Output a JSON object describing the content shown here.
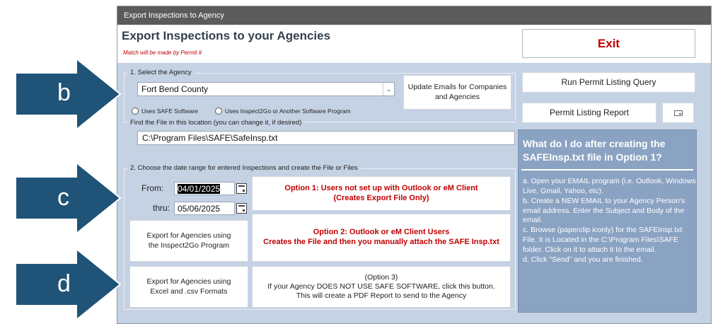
{
  "window": {
    "title": "Export Inspections to Agency",
    "heading": "Export Inspections to your Agencies",
    "subheading": "Match will be made by Permit #"
  },
  "buttons": {
    "exit": "Exit",
    "update_emails": "Update Emails for Companies and Agencies",
    "run_permit_query": "Run Permit Listing Query",
    "permit_report": "Permit Listing Report",
    "option1_line1": "Option 1: Users not set up with Outlook or eM Client",
    "option1_line2": "(Creates Export File Only)",
    "option2_line1": "Option 2: Outlook or eM Client Users",
    "option2_line2": "Creates the File and then you manually attach the SAFE Insp.txt",
    "export_inspect2go_line1": "Export for Agencies using",
    "export_inspect2go_line2": "the Inspect2Go Program",
    "export_excel_line1": "Export for Agencies using",
    "export_excel_line2": "Excel and .csv Formats",
    "option3_line1": "(Option 3)",
    "option3_line2": "If your Agency DOES NOT USE SAFE SOFTWARE, click this button.",
    "option3_line3": "This will create a PDF Report to send to the Agency"
  },
  "section1": {
    "legend": "1. Select the Agency",
    "agency_value": "Fort Bend County",
    "radio_safe": "Uses SAFE Software",
    "radio_other": "Uses Inspect2Go or Another Software Program",
    "file_legend": "Find the File in this location (you can change it, if desired)",
    "file_path": "C:\\Program Files\\SAFE\\SafeInsp.txt"
  },
  "section2": {
    "legend": "2. Choose the date range for entered Inspections and create the File or Files",
    "from_label": "From:",
    "from_value": "04/01/2025",
    "thru_label": "thru:",
    "thru_value": "05/06/2025"
  },
  "help_panel": {
    "title": "What do I do after creating the SAFEInsp.txt file in Option 1?",
    "step_a": "a. Open your EMAIL program (i.e. Outlook, Windows Live, Gmail, Yahoo, etc).",
    "step_b": "b. Create a NEW EMAIL to your Agency Person's email address. Enter the Subject and Body of the email.",
    "step_c": "c. Browse (paperclip iconly) for the SAFEInsp.txt File. It is Located in the C:\\Program Files\\SAFE folder. Click on it to attach it to the email.",
    "step_d": "d. Click \"Send\" and you are finished."
  },
  "callouts": {
    "b": "b",
    "c": "c",
    "d": "d",
    "color": "#1f5377"
  }
}
